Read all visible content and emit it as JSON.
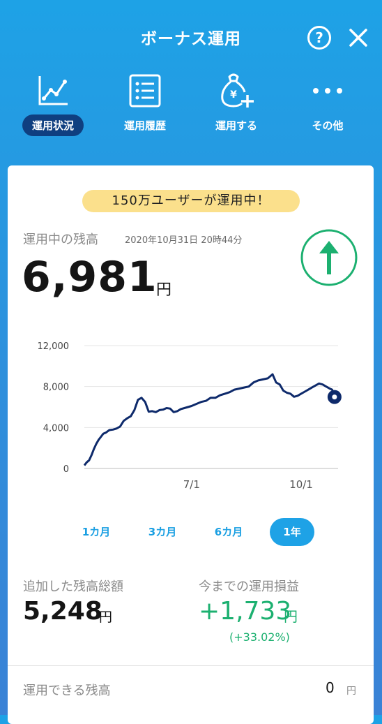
{
  "header": {
    "title": "ボーナス運用",
    "help": "?"
  },
  "nav": [
    {
      "label": "運用状況",
      "icon": "chart-line-icon",
      "active": true
    },
    {
      "label": "運用履歴",
      "icon": "list-icon",
      "active": false
    },
    {
      "label": "運用する",
      "icon": "money-bag-plus-icon",
      "active": false
    },
    {
      "label": "その他",
      "icon": "more-icon",
      "active": false
    }
  ],
  "banner": "150万ユーザーが運用中！",
  "balance": {
    "label": "運用中の残高",
    "timestamp": "2020年10月31日 20時44分",
    "amount": "6,981",
    "unit": "円"
  },
  "colors": {
    "line": "#0e2a6b",
    "accent": "#1ea2e6",
    "gain": "#1cb070",
    "banner": "#fbe08c"
  },
  "chart_data": {
    "type": "line",
    "y_ticks": [
      "12,000",
      "8,000",
      "4,000",
      "0"
    ],
    "ylim": [
      0,
      12000
    ],
    "x_ticks": [
      "7/1",
      "10/1"
    ],
    "x_tick_days": [
      182,
      274
    ],
    "xlim_days": [
      92,
      305
    ],
    "x": [
      92,
      94,
      96,
      98,
      100,
      102,
      104,
      106,
      108,
      110,
      113,
      116,
      119,
      122,
      125,
      128,
      131,
      134,
      137,
      140,
      143,
      146,
      149,
      152,
      155,
      158,
      161,
      164,
      167,
      170,
      173,
      176,
      179,
      182,
      186,
      190,
      194,
      198,
      202,
      206,
      210,
      214,
      218,
      222,
      226,
      230,
      234,
      238,
      242,
      246,
      250,
      253,
      256,
      259,
      262,
      265,
      268,
      271,
      274,
      277,
      280,
      283,
      286,
      289,
      292,
      295,
      298,
      300,
      302
    ],
    "y": [
      300,
      600,
      800,
      1300,
      1900,
      2400,
      2800,
      3100,
      3400,
      3500,
      3750,
      3800,
      3900,
      4100,
      4650,
      4900,
      5100,
      5700,
      6700,
      6900,
      6500,
      5550,
      5600,
      5500,
      5700,
      5750,
      5900,
      5850,
      5500,
      5600,
      5800,
      5900,
      6000,
      6100,
      6300,
      6500,
      6600,
      6900,
      6900,
      7150,
      7300,
      7450,
      7700,
      7800,
      7900,
      8000,
      8400,
      8600,
      8700,
      8800,
      9200,
      8400,
      8200,
      7600,
      7400,
      7300,
      7000,
      7100,
      7300,
      7500,
      7700,
      7900,
      8100,
      8300,
      8200,
      8000,
      7800,
      7700,
      6981
    ],
    "last_point": 6981
  },
  "periods": [
    {
      "label": "1カ月",
      "active": false
    },
    {
      "label": "3カ月",
      "active": false
    },
    {
      "label": "6カ月",
      "active": false
    },
    {
      "label": "1年",
      "active": true
    }
  ],
  "stats": {
    "added_label": "追加した残高総額",
    "added_value": "5,248",
    "added_unit": "円",
    "pl_label": "今までの運用損益",
    "pl_value": "+1,733",
    "pl_unit": "円",
    "pl_pct": "(+33.02%)"
  },
  "available": {
    "label": "運用できる残高",
    "value": "0",
    "unit": "円"
  }
}
